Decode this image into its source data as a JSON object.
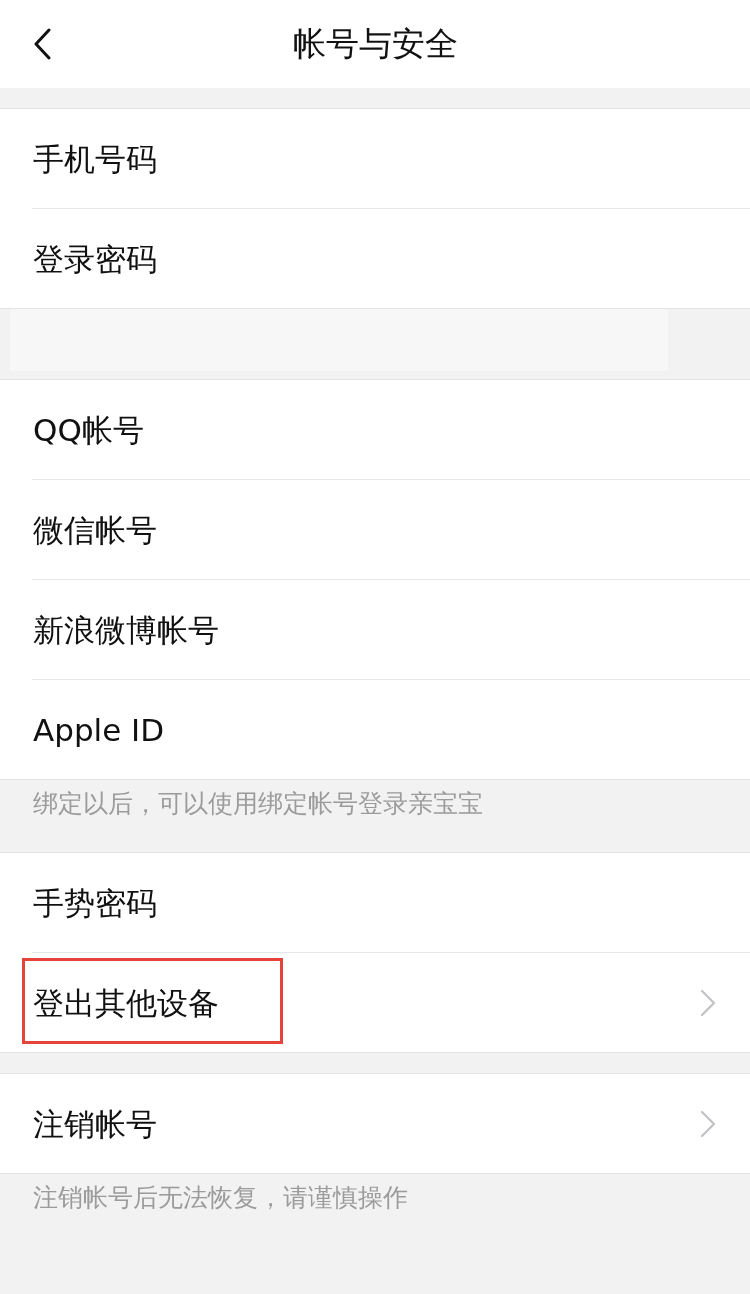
{
  "nav_bar": {
    "title": "帐号与安全"
  },
  "sections": [
    {
      "items": [
        {
          "label": "手机号码",
          "chevron": false,
          "highlighted": false
        },
        {
          "label": "登录密码",
          "chevron": false,
          "highlighted": false
        }
      ],
      "redacted_footer": true
    },
    {
      "items": [
        {
          "label": "QQ帐号",
          "chevron": false,
          "highlighted": false
        },
        {
          "label": "微信帐号",
          "chevron": false,
          "highlighted": false
        },
        {
          "label": "新浪微博帐号",
          "chevron": false,
          "highlighted": false
        },
        {
          "label": "Apple ID",
          "chevron": false,
          "highlighted": false
        }
      ],
      "footer": "绑定以后，可以使用绑定帐号登录亲宝宝"
    },
    {
      "items": [
        {
          "label": "手势密码",
          "chevron": false,
          "highlighted": false
        },
        {
          "label": "登出其他设备",
          "chevron": true,
          "highlighted": true
        }
      ]
    },
    {
      "items": [
        {
          "label": "注销帐号",
          "chevron": true,
          "highlighted": false
        }
      ],
      "footer": "注销帐号后无法恢复，请谨慎操作"
    }
  ]
}
